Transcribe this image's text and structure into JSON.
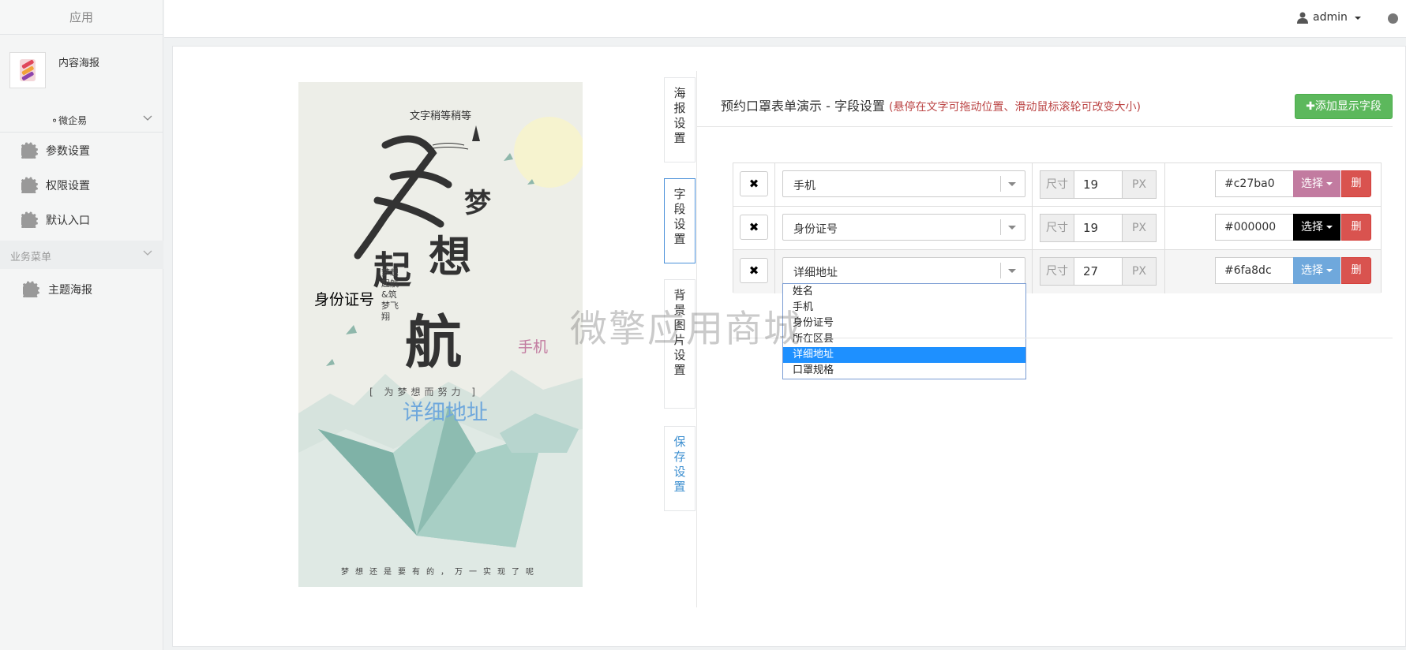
{
  "sidebar": {
    "header": "应用",
    "app_name": "内容海报",
    "company": "微企易",
    "items": [
      {
        "label": "参数设置"
      },
      {
        "label": "权限设置"
      },
      {
        "label": "默认入口"
      }
    ],
    "section_label": "业务菜单",
    "section_items": [
      {
        "label": "主题海报"
      }
    ]
  },
  "topbar": {
    "user": "admin"
  },
  "poster": {
    "subtitle": "文字稍等稍等",
    "id_text": "身份证号",
    "phone_text": "手机",
    "address_text": "详细地址",
    "slogan": "[ 为梦想而努力 ]",
    "vertical_text": "梦想起航&筑梦飞翔",
    "footer": "梦想还是要有的，万一实现了呢",
    "colors": {
      "id": "#000000",
      "phone": "#c27ba0",
      "address": "#6fa8dc"
    }
  },
  "tabs": [
    {
      "label": "海报设置"
    },
    {
      "label": "字段设置"
    },
    {
      "label": "背景图片设置"
    },
    {
      "label": "保存设置"
    }
  ],
  "fields": {
    "title": "预约口罩表单演示 - 字段设置",
    "note": "(悬停在文字可拖动位置、滑动鼠标滚轮可改变大小)",
    "add_button": "添加显示字段",
    "size_label": "尺寸",
    "unit_label": "PX",
    "pick_label": "选择",
    "delete_label": "删",
    "remove_label": "✖",
    "rows": [
      {
        "field": "手机",
        "size": "19",
        "color": "#c27ba0"
      },
      {
        "field": "身份证号",
        "size": "19",
        "color": "#000000"
      },
      {
        "field": "详细地址",
        "size": "27",
        "color": "#6fa8dc"
      }
    ],
    "dropdown_options": [
      "姓名",
      "手机",
      "身份证号",
      "所在区县",
      "详细地址",
      "口罩规格"
    ],
    "dropdown_selected": "详细地址"
  },
  "watermark": "微擎应用商城"
}
